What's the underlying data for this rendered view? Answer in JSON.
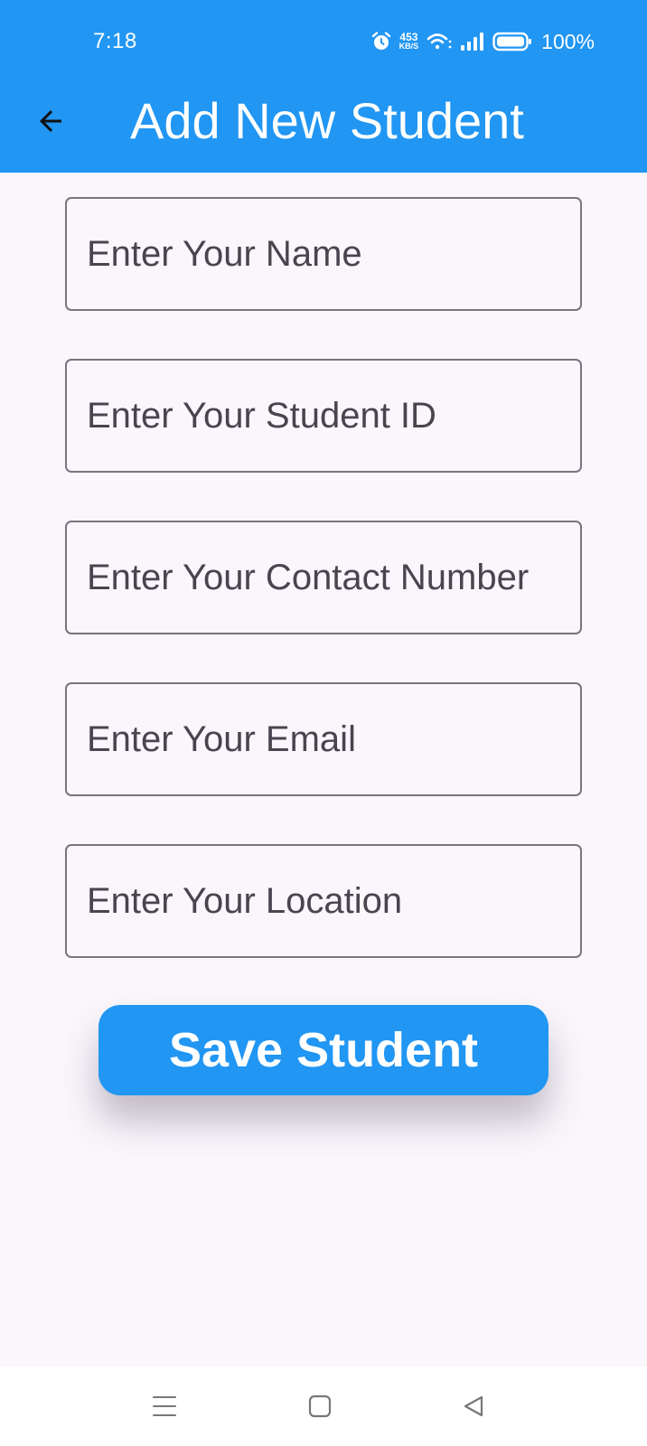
{
  "status_bar": {
    "time": "7:18",
    "net_speed_value": "453",
    "net_speed_unit": "KB/S",
    "battery": "100%",
    "icons": [
      "alarm-icon",
      "wifi-icon",
      "signal-icon",
      "battery-icon"
    ]
  },
  "app_bar": {
    "title": "Add New Student",
    "back_icon": "arrow-back-icon"
  },
  "form": {
    "fields": [
      {
        "placeholder": "Enter Your Name",
        "value": ""
      },
      {
        "placeholder": "Enter Your Student ID",
        "value": ""
      },
      {
        "placeholder": "Enter Your Contact Number",
        "value": ""
      },
      {
        "placeholder": "Enter Your Email",
        "value": ""
      },
      {
        "placeholder": "Enter Your Location",
        "value": ""
      }
    ],
    "submit_label": "Save Student"
  },
  "nav_bar": {
    "icons": [
      "menu-icon",
      "home-icon",
      "back-icon"
    ]
  },
  "colors": {
    "primary": "#2196f3",
    "background": "#fbf6fc",
    "field_border": "#79747e",
    "placeholder": "#49454f",
    "on_primary": "#ffffff"
  }
}
